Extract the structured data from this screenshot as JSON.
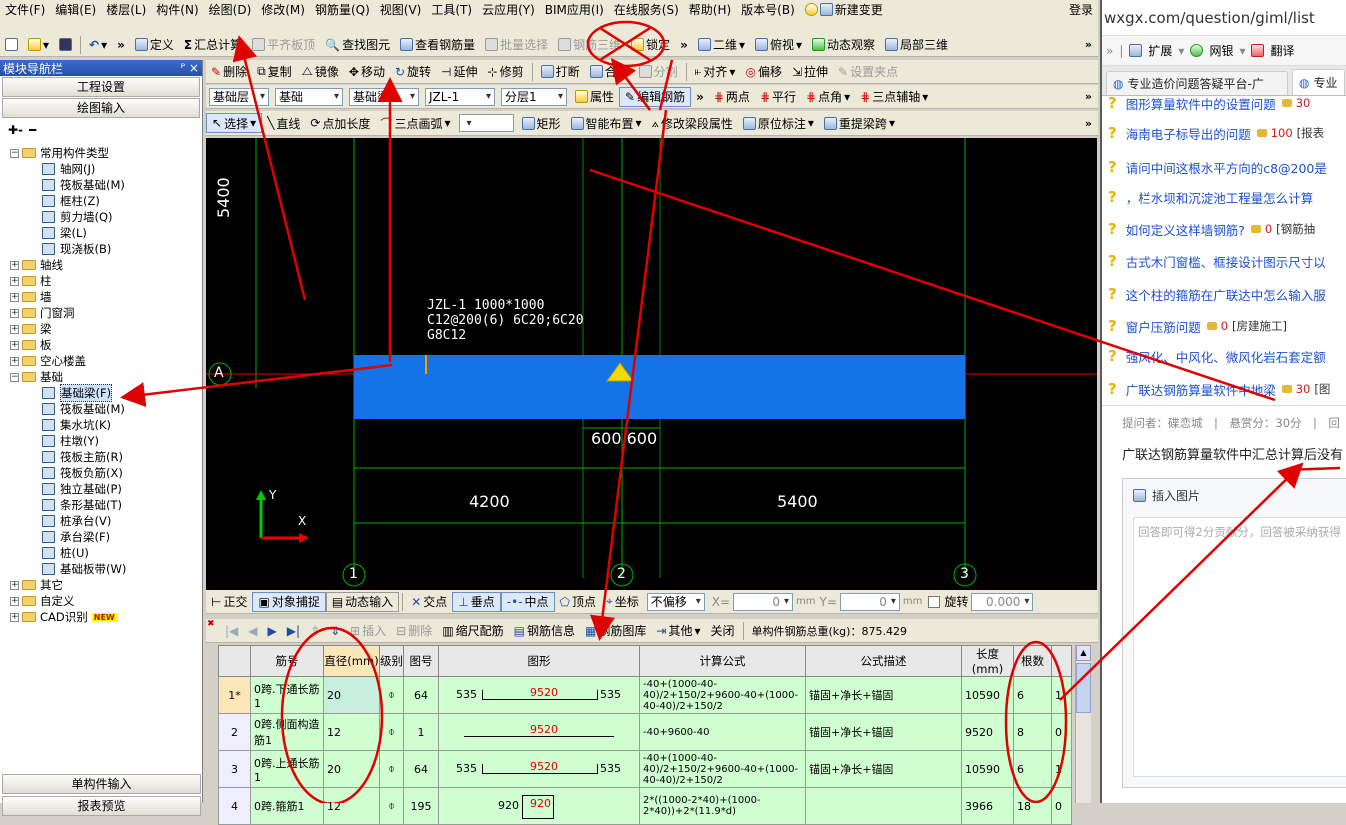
{
  "menu": {
    "items": [
      "文件(F)",
      "编辑(E)",
      "楼层(L)",
      "构件(N)",
      "绘图(D)",
      "修改(M)",
      "钢筋量(Q)",
      "视图(V)",
      "工具(T)",
      "云应用(Y)",
      "BIM应用(I)",
      "在线服务(S)",
      "帮助(H)",
      "版本号(B)"
    ],
    "new_change": "新建变更",
    "login": "登录"
  },
  "toolbar1": {
    "define": "定义",
    "sum_calc": "汇总计算",
    "align_slab": "平齐板顶",
    "find_elem": "查找图元",
    "view_rebar": "查看钢筋量",
    "batch_select": "批量选择",
    "rebar_3d": "钢筋三维",
    "lock": "锁定",
    "view_2d": "二维",
    "top_view": "俯视",
    "dynamic_view": "动态观察",
    "local_3d": "局部三维"
  },
  "toolbar2": {
    "delete": "删除",
    "copy": "复制",
    "mirror": "镜像",
    "move": "移动",
    "rotate": "旋转",
    "extend": "延伸",
    "trim": "修剪",
    "break": "打断",
    "merge": "合并",
    "split": "分割",
    "align": "对齐",
    "offset": "偏移",
    "stretch": "拉伸",
    "set_grip": "设置夹点"
  },
  "toolbar3": {
    "floor_sel": "基础层",
    "type_sel": "基础",
    "elem_sel": "基础梁",
    "name_sel": "JZL-1",
    "layer_sel": "分层1",
    "property": "属性",
    "edit_rebar": "编辑钢筋",
    "two_points": "两点",
    "parallel": "平行",
    "point_angle": "点角",
    "three_point_aux": "三点辅轴"
  },
  "toolbar4": {
    "select": "选择",
    "line": "直线",
    "point_add_len": "点加长度",
    "three_point_arc": "三点画弧",
    "rect": "矩形",
    "smart_layout": "智能布置",
    "modify_seg_prop": "修改梁段属性",
    "in_place_label": "原位标注",
    "re_extract_span": "重提梁跨"
  },
  "panel": {
    "title": "模块导航栏",
    "pin": "ᴾ ×",
    "project_settings": "工程设置",
    "drawing_input": "绘图输入",
    "single_input": "单构件输入",
    "report_preview": "报表预览"
  },
  "tree": {
    "common": "常用构件类型",
    "common_items": [
      "轴网(J)",
      "筏板基础(M)",
      "框柱(Z)",
      "剪力墙(Q)",
      "梁(L)",
      "现浇板(B)"
    ],
    "groups": [
      "轴线",
      "柱",
      "墙",
      "门窗洞",
      "梁",
      "板",
      "空心楼盖"
    ],
    "foundation": "基础",
    "foundation_items": [
      "基础梁(F)",
      "筏板基础(M)",
      "集水坑(K)",
      "柱墩(Y)",
      "筏板主筋(R)",
      "筏板负筋(X)",
      "独立基础(P)",
      "条形基础(T)",
      "桩承台(V)",
      "承台梁(F)",
      "桩(U)",
      "基础板带(W)"
    ],
    "tail_groups": [
      "其它",
      "自定义",
      "CAD识别"
    ],
    "new_badge": "NEW"
  },
  "canvas": {
    "beam_label_1": "JZL-1 1000*1000",
    "beam_label_2": "C12@200(6) 6C20;6C20",
    "beam_label_3": "G8C12",
    "dim_vertical": "5400",
    "axis_a": "A",
    "dim_600": "600 600",
    "dim_left": "4200",
    "dim_right": "5400",
    "axis_1": "1",
    "axis_2": "2",
    "axis_3": "3",
    "ucs_y": "Y",
    "ucs_x": "X"
  },
  "snapbar": {
    "ortho": "正交",
    "obj_snap": "对象捕捉",
    "dyn_input": "动态输入",
    "intersect": "交点",
    "perp": "垂点",
    "mid": "中点",
    "vertex": "顶点",
    "coord": "坐标",
    "no_offset": "不偏移",
    "x_label": "X=",
    "x_val": "0",
    "mm1": "mm",
    "y_label": "Y=",
    "y_val": "0",
    "mm2": "mm",
    "rotate": "旋转",
    "rot_val": "0.000"
  },
  "gridbar": {
    "insert": "插入",
    "delete": "删除",
    "scale_rebar": "缩尺配筋",
    "rebar_info": "钢筋信息",
    "rebar_lib": "钢筋图库",
    "other": "其他",
    "close": "关闭",
    "total": "单构件钢筋总重(kg)：875.429"
  },
  "grid": {
    "headers": [
      "",
      "筋号",
      "直径(mm)",
      "级别",
      "图号",
      "图形",
      "计算公式",
      "公式描述",
      "长度(mm)",
      "根数",
      ""
    ],
    "rows": [
      {
        "n": "1*",
        "name": "0跨.下通长筋1",
        "dia": "20",
        "grade": "⌽",
        "fig": "64",
        "l": "535",
        "mid": "9520",
        "r": "535",
        "formula": "-40+(1000-40-40)/2+150/2+9600-40+(1000-40-40)/2+150/2",
        "desc": "锚固+净长+锚固",
        "len": "10590",
        "count": "6",
        "tail": "1"
      },
      {
        "n": "2",
        "name": "0跨.侧面构造筋1",
        "dia": "12",
        "grade": "⌽",
        "fig": "1",
        "l": "",
        "mid": "9520",
        "r": "",
        "formula": "-40+9600-40",
        "desc": "锚固+净长+锚固",
        "len": "9520",
        "count": "8",
        "tail": "0"
      },
      {
        "n": "3",
        "name": "0跨.上通长筋1",
        "dia": "20",
        "grade": "⌽",
        "fig": "64",
        "l": "535",
        "mid": "9520",
        "r": "535",
        "formula": "-40+(1000-40-40)/2+150/2+9600-40+(1000-40-40)/2+150/2",
        "desc": "锚固+净长+锚固",
        "len": "10590",
        "count": "6",
        "tail": "1"
      },
      {
        "n": "4",
        "name": "0跨.箍筋1",
        "dia": "12",
        "grade": "⌽",
        "fig": "195",
        "l": "920",
        "mid": "920",
        "r": "",
        "formula": "2*((1000-2*40)+(1000-2*40))+2*(11.9*d)",
        "desc": "",
        "len": "3966",
        "count": "18",
        "tail": "0"
      }
    ]
  },
  "browser": {
    "url": "wxgx.com/question/giml/list",
    "ext": "扩展",
    "netbank": "网银",
    "translate": "翻译",
    "tab1": "专业造价问题答疑平台-广",
    "tab2": "专业",
    "questions": [
      {
        "t": "图形算量软件中的设置问题",
        "n": "30"
      },
      {
        "t": "海南电子标导出的问题",
        "n": "100",
        "tag": "[报表"
      },
      {
        "t": "请问中间这根水平方向的c8@200是",
        "n": ""
      },
      {
        "t": "，栏水坝和沉淀池工程量怎么计算",
        "n": ""
      },
      {
        "t": "如何定义这样墙钢筋?",
        "n": "0",
        "tag": "[钢筋抽"
      },
      {
        "t": "古式木门窗槛、框接设计图示尺寸以",
        "n": ""
      },
      {
        "t": "这个柱的箍筋在广联达中怎么输入服",
        "n": ""
      },
      {
        "t": "窗户压筋问题",
        "n": "0",
        "tag": "[房建施工]"
      },
      {
        "t": "强风化、中风化、微风化岩石套定额",
        "n": ""
      },
      {
        "t": "广联达钢筋算量软件中地梁",
        "n": "30",
        "tag": "[图"
      }
    ],
    "asker": "提问者：碟恋城　|　悬赏分：30分　|　回",
    "question_text": "广联达钢筋算量软件中汇总计算后没有",
    "insert_image": "插入图片",
    "answer_hint": "回答即可得2分贡献分，回答被采纳获得"
  },
  "colors": {
    "beam": "#1573e8",
    "axis": "#00b000",
    "red_annot": "#e00000"
  }
}
